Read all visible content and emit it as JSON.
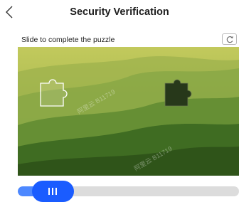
{
  "header": {
    "title": "Security Verification",
    "back_icon": "chevron-left-icon"
  },
  "puzzle": {
    "instruction": "Slide to complete the puzzle",
    "refresh_label": "C",
    "watermarks": [
      "阿里云 B11719",
      "阿里云 B11719"
    ]
  },
  "slider": {
    "handle_icon": "three-bars-grip-icon",
    "progress_fraction": 0.12
  },
  "colors": {
    "accent": "#1a5cff",
    "track": "#dcdcdc",
    "sky_top": "#c9cf63",
    "forest_dark": "#2f4a18"
  }
}
